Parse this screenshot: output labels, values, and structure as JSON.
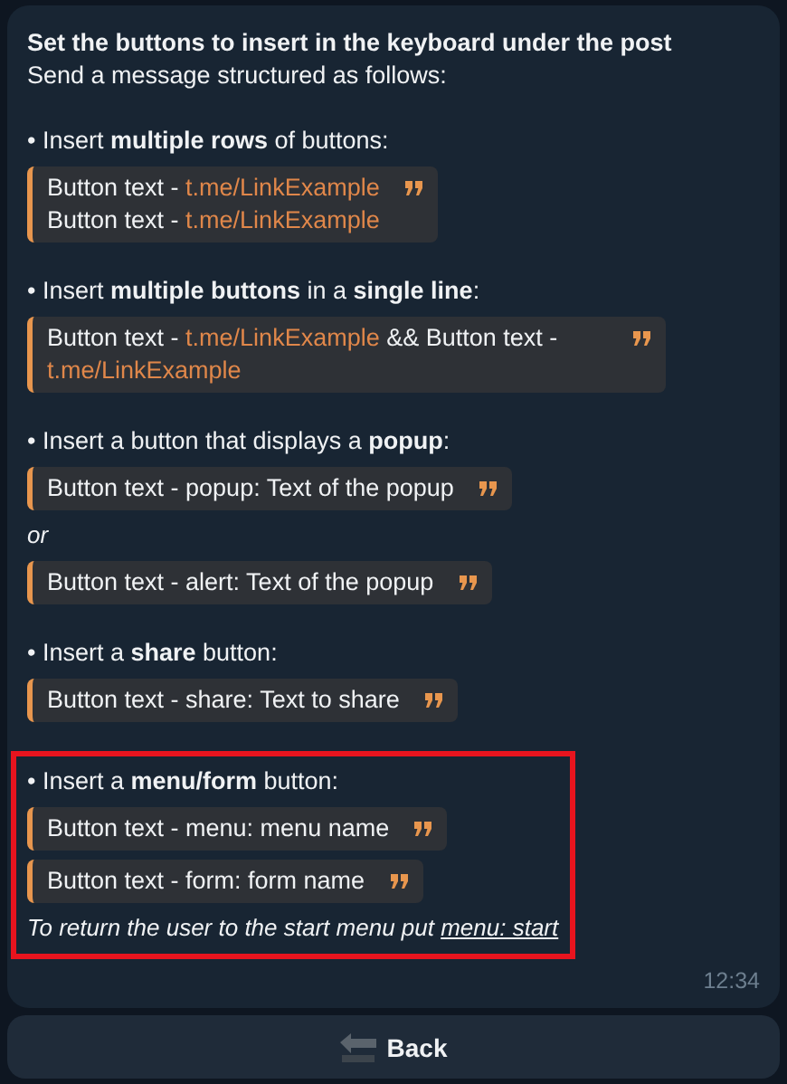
{
  "message": {
    "title": "Set the buttons to insert in the keyboard under the post",
    "subtitle": "Send a message structured as follows:",
    "sections": [
      {
        "heading": "• Insert **multiple rows** of buttons:",
        "highlighted": false,
        "items": [
          {
            "kind": "quote",
            "lines": [
              [
                {
                  "text": "Button text - "
                },
                {
                  "text": "t.me/LinkExample",
                  "kind": "link"
                }
              ],
              [
                {
                  "text": "Button text - "
                },
                {
                  "text": "t.me/LinkExample",
                  "kind": "link"
                }
              ]
            ]
          }
        ]
      },
      {
        "heading": "• Insert **multiple buttons** in a **single line**:",
        "highlighted": false,
        "items": [
          {
            "kind": "quote",
            "lines": [
              [
                {
                  "text": "Button text - "
                },
                {
                  "text": "t.me/LinkExample",
                  "kind": "link"
                },
                {
                  "text": " && Button text - "
                },
                {
                  "text": "t.me/LinkExample",
                  "kind": "link"
                }
              ]
            ]
          }
        ]
      },
      {
        "heading": "• Insert a button that displays a **popup**:",
        "highlighted": false,
        "items": [
          {
            "kind": "quote",
            "lines": [
              [
                {
                  "text": "Button text - popup: Text of the popup"
                }
              ]
            ]
          },
          {
            "kind": "note",
            "parts": [
              {
                "text": "or"
              }
            ]
          },
          {
            "kind": "quote",
            "lines": [
              [
                {
                  "text": "Button text - alert: Text of the popup"
                }
              ]
            ]
          }
        ]
      },
      {
        "heading": "• Insert a **share** button:",
        "highlighted": false,
        "items": [
          {
            "kind": "quote",
            "lines": [
              [
                {
                  "text": "Button text - share: Text to share"
                }
              ]
            ]
          }
        ]
      },
      {
        "heading": "• Insert a **menu/form** button:",
        "highlighted": true,
        "items": [
          {
            "kind": "quote",
            "lines": [
              [
                {
                  "text": "Button text - menu: menu name"
                }
              ]
            ]
          },
          {
            "kind": "quote",
            "lines": [
              [
                {
                  "text": "Button text - form: form name"
                }
              ]
            ]
          },
          {
            "kind": "note",
            "parts": [
              {
                "text": "To return the user to the start menu put "
              },
              {
                "text": "menu: start",
                "kind": "underline"
              }
            ]
          }
        ]
      }
    ],
    "time": "12:34"
  },
  "keyboard": [
    {
      "label": "Back"
    }
  ]
}
